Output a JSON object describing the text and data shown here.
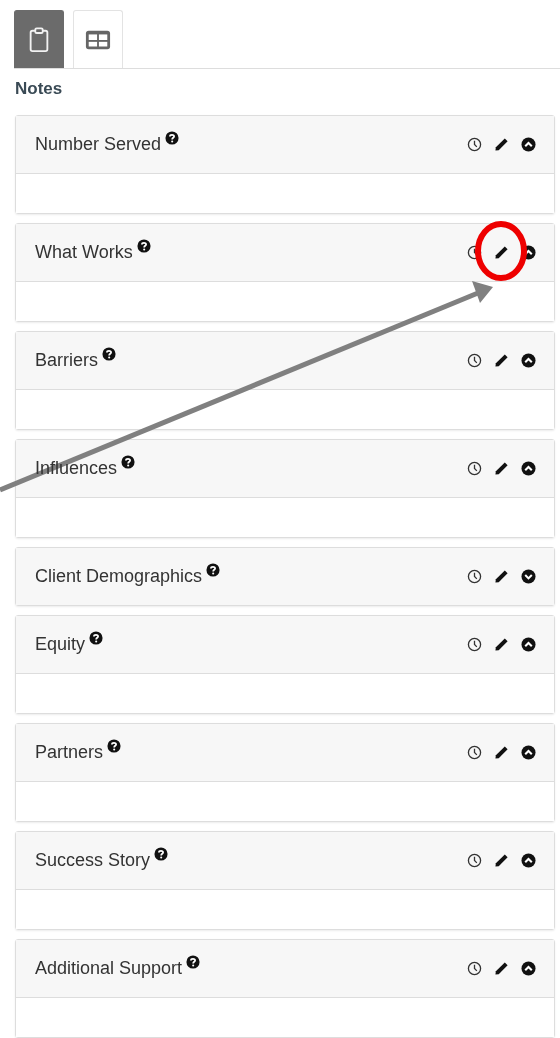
{
  "tabs": [
    {
      "kind": "notes",
      "selected": true
    },
    {
      "kind": "table",
      "selected": false
    }
  ],
  "section_title": "Notes",
  "panels": [
    {
      "title": "Number Served",
      "expanded": true
    },
    {
      "title": "What Works",
      "expanded": true
    },
    {
      "title": "Barriers",
      "expanded": true
    },
    {
      "title": "Influences",
      "expanded": true
    },
    {
      "title": "Client Demographics",
      "expanded": false
    },
    {
      "title": "Equity",
      "expanded": true
    },
    {
      "title": "Partners",
      "expanded": true
    },
    {
      "title": "Success Story",
      "expanded": true
    },
    {
      "title": "Additional Support",
      "expanded": true
    }
  ]
}
